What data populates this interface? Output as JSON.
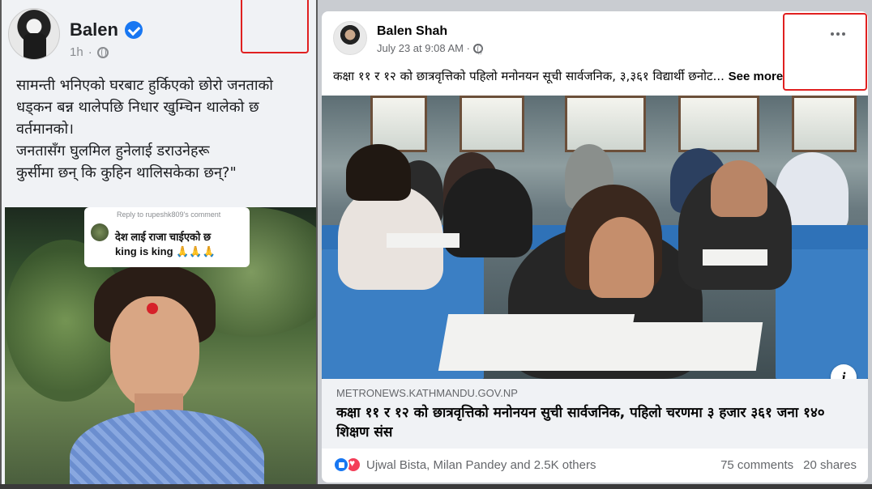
{
  "left_post": {
    "author": "Balen",
    "time": "1h",
    "text_lines": [
      "सामन्ती भनिएको घरबाट हुर्किएको छोरो जनताको",
      "धड्कन बन्न थालेपछि निधार खुम्चिन थालेको छ",
      "वर्तमानको।",
      "जनतासँग घुलमिल हुनेलाई डराउनेहरू",
      "कुर्सीमा छन् कि कुहिन थालिसकेका छन्?\""
    ],
    "reply": {
      "reply_to": "Reply to rupeshk809's comment",
      "line1": "देश लाई राजा चाईएको छ",
      "line2": "king is king 🙏🙏🙏"
    }
  },
  "right_post": {
    "author": "Balen Shah",
    "time": "July 23 at 9:08 AM ·",
    "caption": "कक्षा ११ र १२ को छात्रवृत्तिको पहिलो मनोनयन सूची सार्वजनिक, ३,३६१ विद्यार्थी छनोट...",
    "see_more": "See more",
    "link": {
      "domain": "METRONEWS.KATHMANDU.GOV.NP",
      "title": "कक्षा ११ र १२ को छात्रवृत्तिको मनोनयन सुची सार्वजनिक, पहिलो चरणमा ३ हजार ३६१ जना १४० शिक्षण संस"
    },
    "reactors": "Ujwal Bista, Milan Pandey and 2.5K others",
    "comments": "75 comments",
    "shares": "20 shares",
    "info_icon": "i"
  },
  "colors": {
    "facebook_blue": "#1877f2",
    "love_red": "#f33e58",
    "annotation_red": "#e02020"
  },
  "icons": [
    "verified-icon",
    "globe-icon",
    "more-icon",
    "like-icon",
    "love-icon",
    "info-icon"
  ]
}
